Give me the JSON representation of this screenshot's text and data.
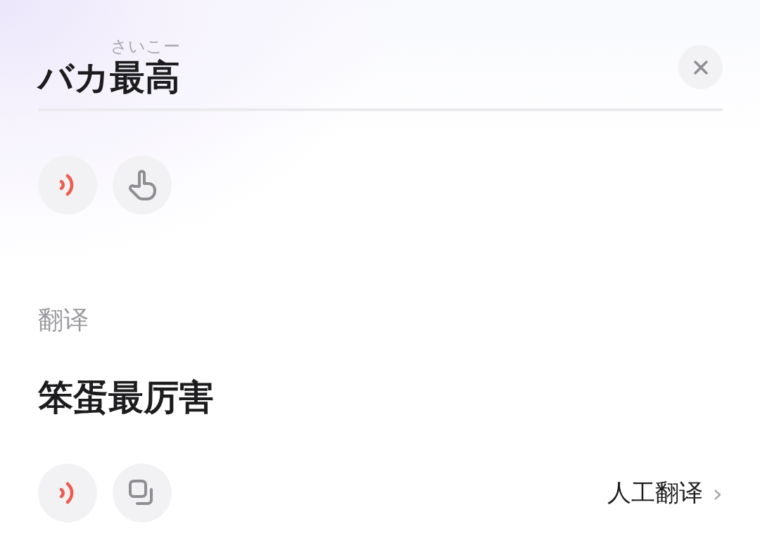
{
  "source": {
    "segments": [
      {
        "text": "バカ"
      },
      {
        "text": "最高",
        "ruby": "さいこー"
      }
    ]
  },
  "source_actions": [
    {
      "kind": "speak"
    },
    {
      "kind": "touch"
    }
  ],
  "translation": {
    "label": "翻译",
    "text": "笨蛋最厉害"
  },
  "translation_actions": [
    {
      "kind": "speak"
    },
    {
      "kind": "copy"
    }
  ],
  "human_translation": {
    "label": "人工翻译",
    "arrow": "›"
  }
}
